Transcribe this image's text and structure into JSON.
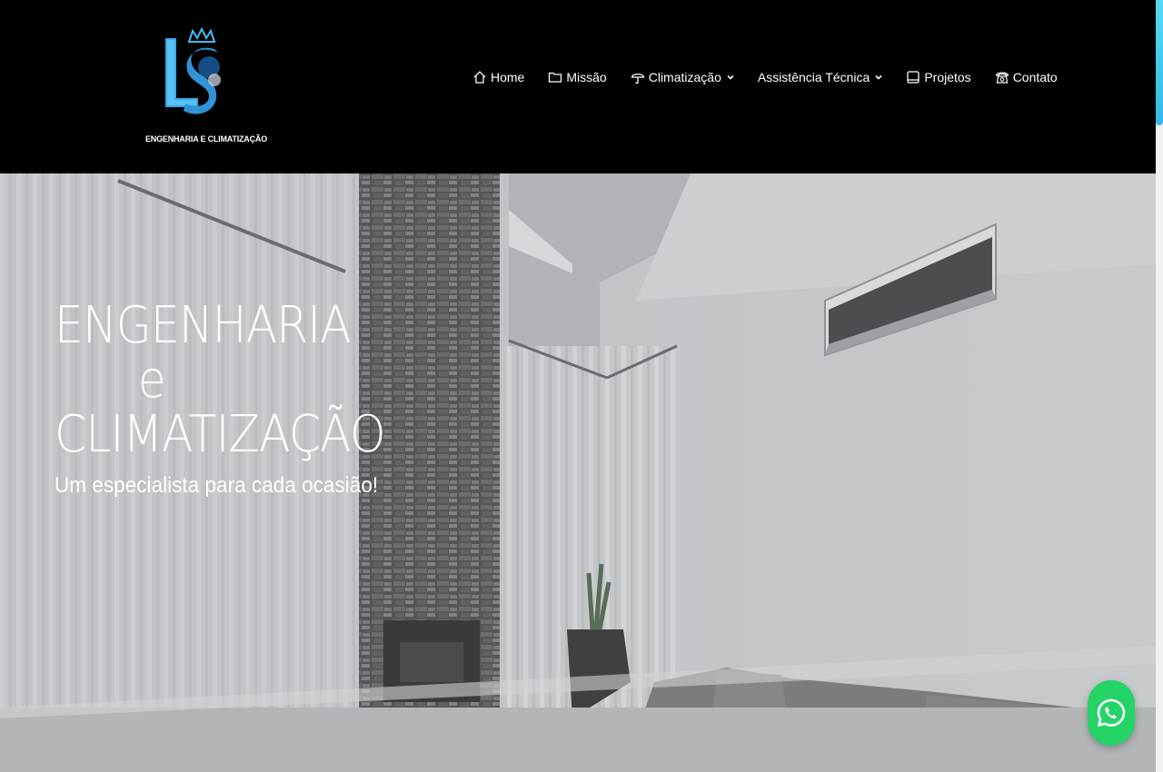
{
  "logo": {
    "caption": "ENGENHARIA E CLIMATIZAÇÃO"
  },
  "nav": {
    "items": [
      {
        "label": "Home",
        "icon": "home-icon"
      },
      {
        "label": "Missão",
        "icon": "folder-icon"
      },
      {
        "label": "Climatização",
        "icon": "umbrella-icon",
        "dropdown": true
      },
      {
        "label": "Assistência Técnica",
        "dropdown": true
      },
      {
        "label": "Projetos",
        "icon": "tablet-icon"
      },
      {
        "label": "Contato",
        "icon": "phone-icon"
      }
    ]
  },
  "hero": {
    "title_line1": "ENGENHARIA",
    "title_line2": "e",
    "title_line3": "CLIMATIZAÇÃO",
    "subtitle": "Um especialista para cada ocasião!"
  },
  "colors": {
    "header_bg": "#000000",
    "accent": "#33b9e6",
    "whatsapp": "#25d366",
    "text": "#ffffff"
  }
}
